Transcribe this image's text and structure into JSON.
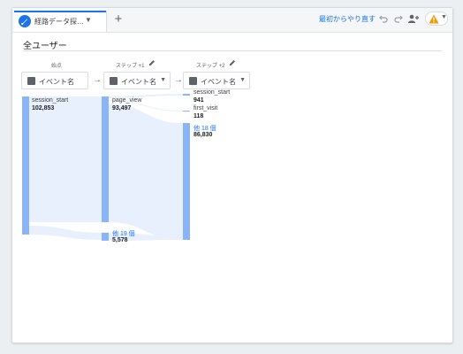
{
  "tab": {
    "title": "経路データ探…"
  },
  "toolbar": {
    "reset_label": "最初からやり直す"
  },
  "segment": {
    "title": "全ユーザー"
  },
  "steps": [
    {
      "label": "始点",
      "dropdown": "イベント名"
    },
    {
      "label": "ステップ +1",
      "dropdown": "イベント名"
    },
    {
      "label": "ステップ +2",
      "dropdown": "イベント名"
    }
  ],
  "nodes": {
    "start": {
      "name": "session_start",
      "value": "102,853"
    },
    "step1_main": {
      "name": "page_view",
      "value": "93,497"
    },
    "step1_other": {
      "name": "他 19 個",
      "value": "5,578"
    },
    "step2_a": {
      "name": "session_start",
      "value": "941"
    },
    "step2_b": {
      "name": "first_visit",
      "value": "118"
    },
    "step2_other": {
      "name": "他 18 個",
      "value": "86,830"
    }
  },
  "colors": {
    "node": "#8ab4f8",
    "flow": "#e8f0fe",
    "accent": "#1a73e8",
    "warning": "#f29900"
  }
}
